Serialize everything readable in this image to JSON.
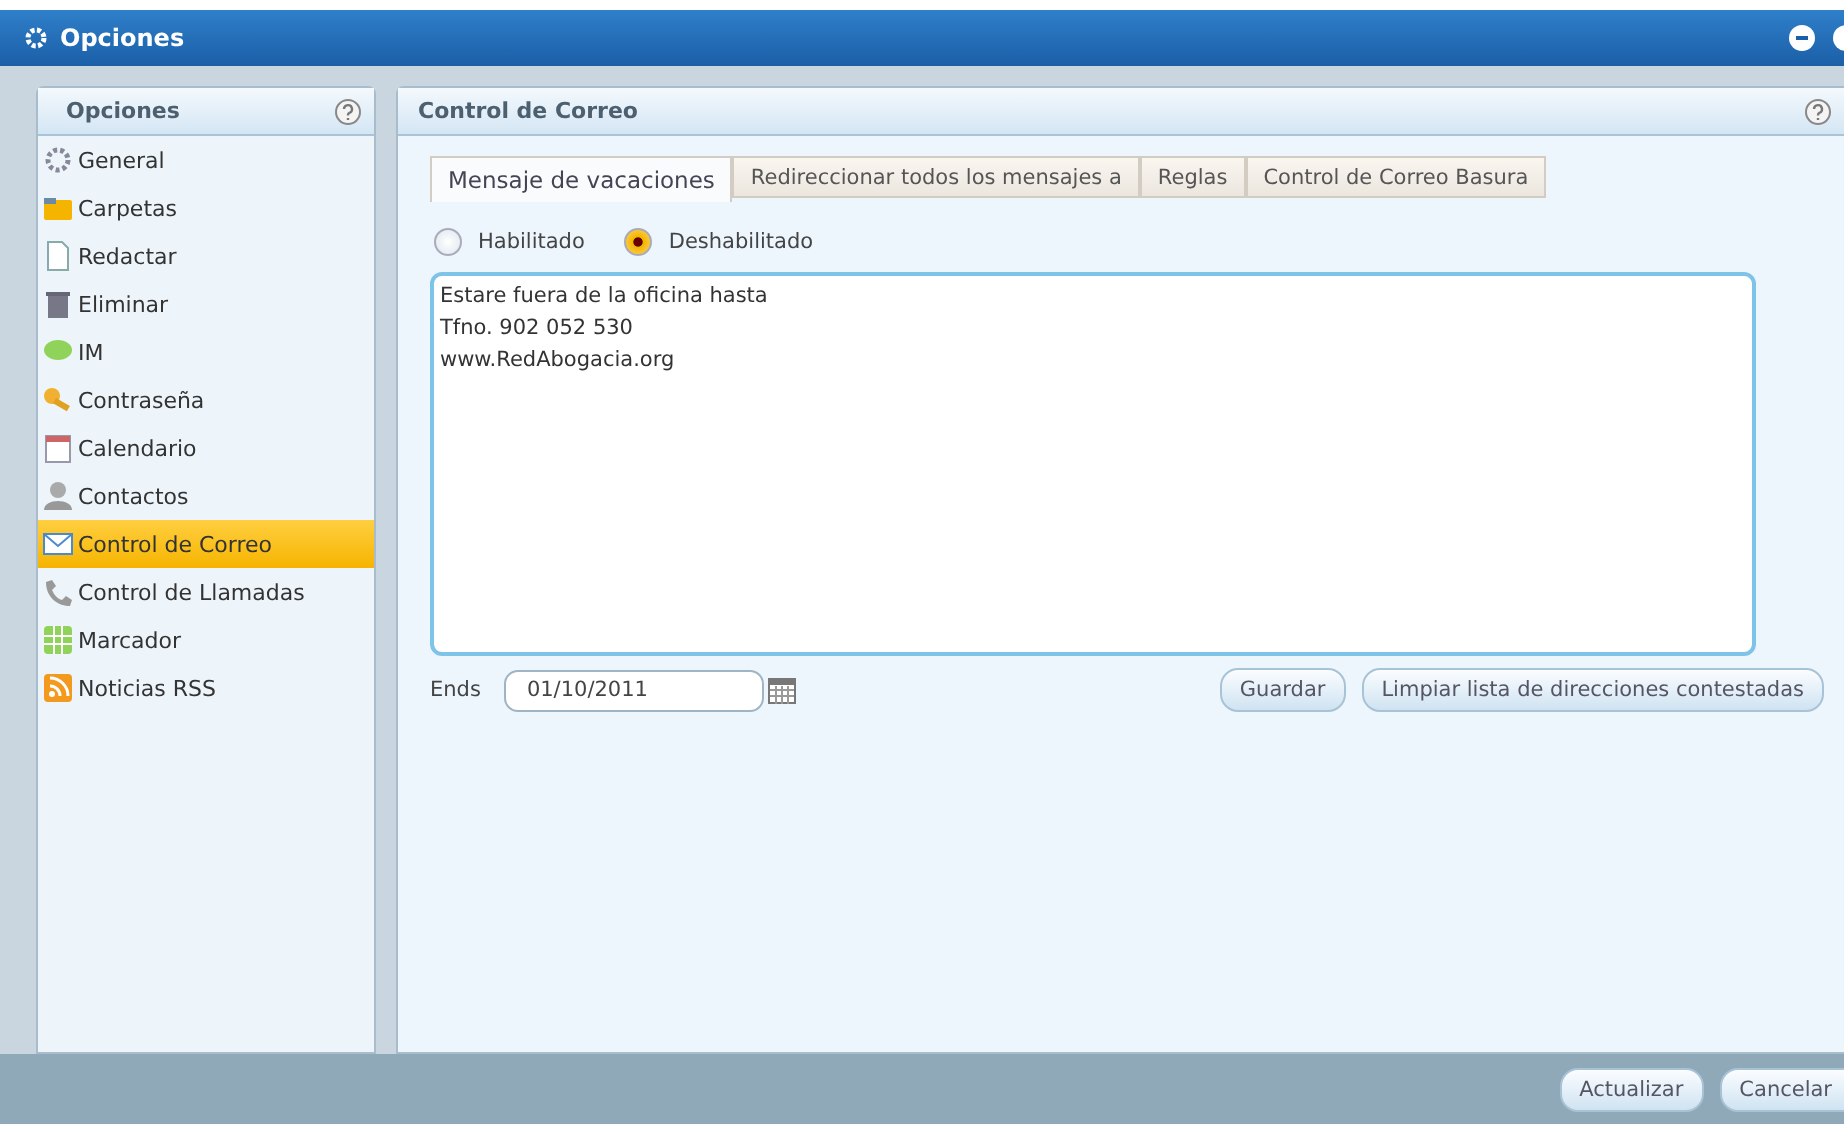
{
  "window": {
    "title": "Opciones"
  },
  "sidebar": {
    "title": "Opciones",
    "items": [
      {
        "label": "General",
        "selected": false
      },
      {
        "label": "Carpetas",
        "selected": false
      },
      {
        "label": "Redactar",
        "selected": false
      },
      {
        "label": "Eliminar",
        "selected": false
      },
      {
        "label": "IM",
        "selected": false
      },
      {
        "label": "Contraseña",
        "selected": false
      },
      {
        "label": "Calendario",
        "selected": false
      },
      {
        "label": "Contactos",
        "selected": false
      },
      {
        "label": "Control de Correo",
        "selected": true
      },
      {
        "label": "Control de Llamadas",
        "selected": false
      },
      {
        "label": "Marcador",
        "selected": false
      },
      {
        "label": "Noticias RSS",
        "selected": false
      }
    ]
  },
  "panel": {
    "title": "Control de Correo",
    "tabs": [
      {
        "label": "Mensaje de vacaciones",
        "selected": true
      },
      {
        "label": "Redireccionar todos los mensajes a",
        "selected": false
      },
      {
        "label": "Reglas",
        "selected": false
      },
      {
        "label": "Control de Correo Basura",
        "selected": false
      }
    ],
    "radios": [
      {
        "label": "Habilitado",
        "selected": false
      },
      {
        "label": "Deshabilitado",
        "selected": true
      }
    ],
    "message_lines": [
      "Estare fuera de la oficina hasta",
      "Tfno. 902 052 530",
      "www.RedAbogacia.org"
    ],
    "ends_label": "Ends",
    "ends_value": "01/10/2011",
    "buttons": [
      "Guardar",
      "Limpiar lista de direcciones contestadas"
    ]
  },
  "footer_buttons": [
    "Actualizar",
    "Cancelar"
  ]
}
